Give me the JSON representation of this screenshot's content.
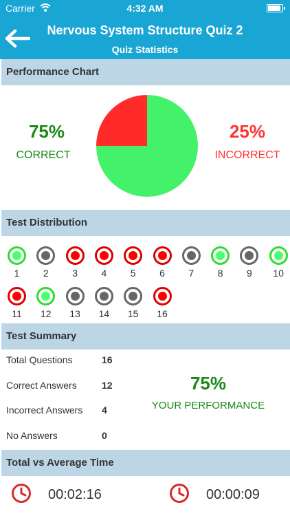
{
  "status": {
    "carrier": "Carrier",
    "time": "4:32 AM"
  },
  "nav": {
    "title": "Nervous System Structure Quiz 2",
    "subtitle": "Quiz Statistics"
  },
  "sections": {
    "performance": "Performance Chart",
    "distribution": "Test Distribution",
    "summary": "Test Summary",
    "time": "Total vs Average Time"
  },
  "performance": {
    "correct_pct": "75%",
    "correct_label": "CORRECT",
    "incorrect_pct": "25%",
    "incorrect_label": "INCORRECT"
  },
  "chart_data": {
    "type": "pie",
    "slices": [
      {
        "name": "CORRECT",
        "value": 75,
        "color": "#44f26a"
      },
      {
        "name": "INCORRECT",
        "value": 25,
        "color": "#ff2b2b"
      }
    ]
  },
  "distribution": [
    {
      "n": "1",
      "status": "correct"
    },
    {
      "n": "2",
      "status": "skipped"
    },
    {
      "n": "3",
      "status": "incorrect"
    },
    {
      "n": "4",
      "status": "incorrect"
    },
    {
      "n": "5",
      "status": "incorrect"
    },
    {
      "n": "6",
      "status": "incorrect"
    },
    {
      "n": "7",
      "status": "skipped"
    },
    {
      "n": "8",
      "status": "correct"
    },
    {
      "n": "9",
      "status": "skipped"
    },
    {
      "n": "10",
      "status": "correct"
    },
    {
      "n": "11",
      "status": "incorrect"
    },
    {
      "n": "12",
      "status": "correct"
    },
    {
      "n": "13",
      "status": "skipped"
    },
    {
      "n": "14",
      "status": "skipped"
    },
    {
      "n": "15",
      "status": "skipped"
    },
    {
      "n": "16",
      "status": "incorrect"
    }
  ],
  "summary": {
    "rows": [
      {
        "label": "Total Questions",
        "value": "16"
      },
      {
        "label": "Correct Answers",
        "value": "12"
      },
      {
        "label": "Incorrect Answers",
        "value": "4"
      },
      {
        "label": "No Answers",
        "value": "0"
      }
    ],
    "performance_pct": "75%",
    "performance_label": "YOUR PERFORMANCE"
  },
  "time": {
    "total": "00:02:16",
    "average": "00:00:09"
  },
  "colors": {
    "brand": "#1aa6d4",
    "section_bg": "#bcd6e6",
    "correct": "#1a8a1a",
    "incorrect": "#ff3333"
  }
}
